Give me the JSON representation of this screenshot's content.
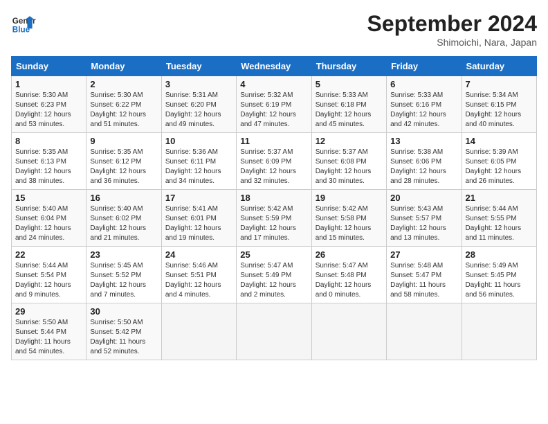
{
  "header": {
    "logo_line1": "General",
    "logo_line2": "Blue",
    "month": "September 2024",
    "location": "Shimoichi, Nara, Japan"
  },
  "weekdays": [
    "Sunday",
    "Monday",
    "Tuesday",
    "Wednesday",
    "Thursday",
    "Friday",
    "Saturday"
  ],
  "weeks": [
    [
      {
        "day": "1",
        "info": "Sunrise: 5:30 AM\nSunset: 6:23 PM\nDaylight: 12 hours\nand 53 minutes."
      },
      {
        "day": "2",
        "info": "Sunrise: 5:30 AM\nSunset: 6:22 PM\nDaylight: 12 hours\nand 51 minutes."
      },
      {
        "day": "3",
        "info": "Sunrise: 5:31 AM\nSunset: 6:20 PM\nDaylight: 12 hours\nand 49 minutes."
      },
      {
        "day": "4",
        "info": "Sunrise: 5:32 AM\nSunset: 6:19 PM\nDaylight: 12 hours\nand 47 minutes."
      },
      {
        "day": "5",
        "info": "Sunrise: 5:33 AM\nSunset: 6:18 PM\nDaylight: 12 hours\nand 45 minutes."
      },
      {
        "day": "6",
        "info": "Sunrise: 5:33 AM\nSunset: 6:16 PM\nDaylight: 12 hours\nand 42 minutes."
      },
      {
        "day": "7",
        "info": "Sunrise: 5:34 AM\nSunset: 6:15 PM\nDaylight: 12 hours\nand 40 minutes."
      }
    ],
    [
      {
        "day": "8",
        "info": "Sunrise: 5:35 AM\nSunset: 6:13 PM\nDaylight: 12 hours\nand 38 minutes."
      },
      {
        "day": "9",
        "info": "Sunrise: 5:35 AM\nSunset: 6:12 PM\nDaylight: 12 hours\nand 36 minutes."
      },
      {
        "day": "10",
        "info": "Sunrise: 5:36 AM\nSunset: 6:11 PM\nDaylight: 12 hours\nand 34 minutes."
      },
      {
        "day": "11",
        "info": "Sunrise: 5:37 AM\nSunset: 6:09 PM\nDaylight: 12 hours\nand 32 minutes."
      },
      {
        "day": "12",
        "info": "Sunrise: 5:37 AM\nSunset: 6:08 PM\nDaylight: 12 hours\nand 30 minutes."
      },
      {
        "day": "13",
        "info": "Sunrise: 5:38 AM\nSunset: 6:06 PM\nDaylight: 12 hours\nand 28 minutes."
      },
      {
        "day": "14",
        "info": "Sunrise: 5:39 AM\nSunset: 6:05 PM\nDaylight: 12 hours\nand 26 minutes."
      }
    ],
    [
      {
        "day": "15",
        "info": "Sunrise: 5:40 AM\nSunset: 6:04 PM\nDaylight: 12 hours\nand 24 minutes."
      },
      {
        "day": "16",
        "info": "Sunrise: 5:40 AM\nSunset: 6:02 PM\nDaylight: 12 hours\nand 21 minutes."
      },
      {
        "day": "17",
        "info": "Sunrise: 5:41 AM\nSunset: 6:01 PM\nDaylight: 12 hours\nand 19 minutes."
      },
      {
        "day": "18",
        "info": "Sunrise: 5:42 AM\nSunset: 5:59 PM\nDaylight: 12 hours\nand 17 minutes."
      },
      {
        "day": "19",
        "info": "Sunrise: 5:42 AM\nSunset: 5:58 PM\nDaylight: 12 hours\nand 15 minutes."
      },
      {
        "day": "20",
        "info": "Sunrise: 5:43 AM\nSunset: 5:57 PM\nDaylight: 12 hours\nand 13 minutes."
      },
      {
        "day": "21",
        "info": "Sunrise: 5:44 AM\nSunset: 5:55 PM\nDaylight: 12 hours\nand 11 minutes."
      }
    ],
    [
      {
        "day": "22",
        "info": "Sunrise: 5:44 AM\nSunset: 5:54 PM\nDaylight: 12 hours\nand 9 minutes."
      },
      {
        "day": "23",
        "info": "Sunrise: 5:45 AM\nSunset: 5:52 PM\nDaylight: 12 hours\nand 7 minutes."
      },
      {
        "day": "24",
        "info": "Sunrise: 5:46 AM\nSunset: 5:51 PM\nDaylight: 12 hours\nand 4 minutes."
      },
      {
        "day": "25",
        "info": "Sunrise: 5:47 AM\nSunset: 5:49 PM\nDaylight: 12 hours\nand 2 minutes."
      },
      {
        "day": "26",
        "info": "Sunrise: 5:47 AM\nSunset: 5:48 PM\nDaylight: 12 hours\nand 0 minutes."
      },
      {
        "day": "27",
        "info": "Sunrise: 5:48 AM\nSunset: 5:47 PM\nDaylight: 11 hours\nand 58 minutes."
      },
      {
        "day": "28",
        "info": "Sunrise: 5:49 AM\nSunset: 5:45 PM\nDaylight: 11 hours\nand 56 minutes."
      }
    ],
    [
      {
        "day": "29",
        "info": "Sunrise: 5:50 AM\nSunset: 5:44 PM\nDaylight: 11 hours\nand 54 minutes."
      },
      {
        "day": "30",
        "info": "Sunrise: 5:50 AM\nSunset: 5:42 PM\nDaylight: 11 hours\nand 52 minutes."
      },
      {
        "day": "",
        "info": ""
      },
      {
        "day": "",
        "info": ""
      },
      {
        "day": "",
        "info": ""
      },
      {
        "day": "",
        "info": ""
      },
      {
        "day": "",
        "info": ""
      }
    ]
  ]
}
